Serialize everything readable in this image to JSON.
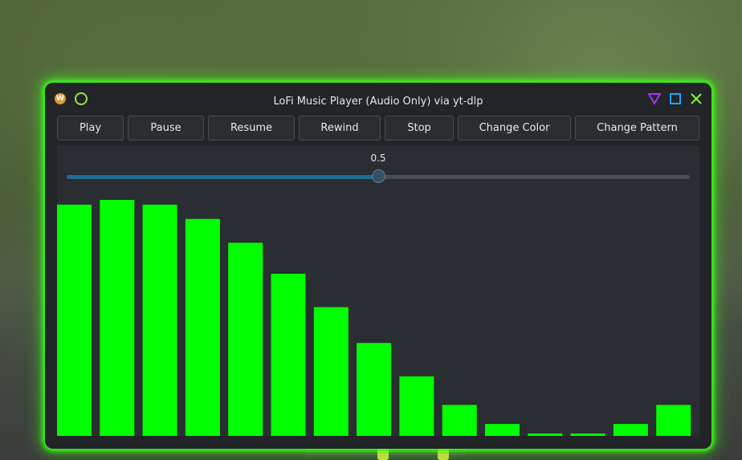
{
  "window": {
    "title": "LoFi Music Player (Audio Only) via yt-dlp",
    "app_icon_letter": "W"
  },
  "toolbar": {
    "buttons": [
      {
        "label": "Play"
      },
      {
        "label": "Pause"
      },
      {
        "label": "Resume"
      },
      {
        "label": "Rewind"
      },
      {
        "label": "Stop"
      },
      {
        "label": "Change Color"
      },
      {
        "label": "Change Pattern"
      }
    ]
  },
  "volume_slider": {
    "value_label": "0.5",
    "value": 0.5,
    "accent_color": "#1f6a97"
  },
  "visualizer": {
    "bar_color": "#00ff00",
    "levels": [
      0.97,
      0.99,
      0.97,
      0.91,
      0.81,
      0.68,
      0.54,
      0.39,
      0.25,
      0.13,
      0.05,
      0.01,
      0.01,
      0.05,
      0.13
    ]
  },
  "colors": {
    "glow": "#39ff14",
    "window_bg": "#222427",
    "icon_min": "#a236ff",
    "icon_max": "#1aa3ff",
    "icon_close": "#7cff3a"
  }
}
